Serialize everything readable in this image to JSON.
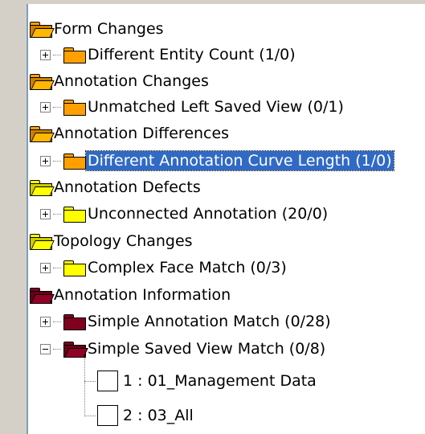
{
  "colors": {
    "orange": "#ffa000",
    "yellow": "#ffff00",
    "maroon": "#800020",
    "selection": "#316ac5"
  },
  "tree": [
    {
      "label": "Form Changes",
      "color": "orange"
    },
    {
      "label": "Different Entity Count (1/0)",
      "color": "orange"
    },
    {
      "label": "Annotation Changes",
      "color": "orange"
    },
    {
      "label": "Unmatched Left Saved View (0/1)",
      "color": "orange"
    },
    {
      "label": "Annotation Differences",
      "color": "orange"
    },
    {
      "label": "Different Annotation Curve Length (1/0)",
      "color": "orange"
    },
    {
      "label": "Annotation Defects",
      "color": "yellow"
    },
    {
      "label": "Unconnected Annotation (20/0)",
      "color": "yellow"
    },
    {
      "label": "Topology Changes",
      "color": "yellow"
    },
    {
      "label": "Complex Face Match (0/3)",
      "color": "yellow"
    },
    {
      "label": "Annotation Information",
      "color": "maroon"
    },
    {
      "label": "Simple Annotation Match (0/28)",
      "color": "maroon"
    },
    {
      "label": "Simple Saved View Match (0/8)",
      "color": "maroon"
    },
    {
      "label": "1 : 01_Management Data"
    },
    {
      "label": "2 : 03_All"
    }
  ]
}
